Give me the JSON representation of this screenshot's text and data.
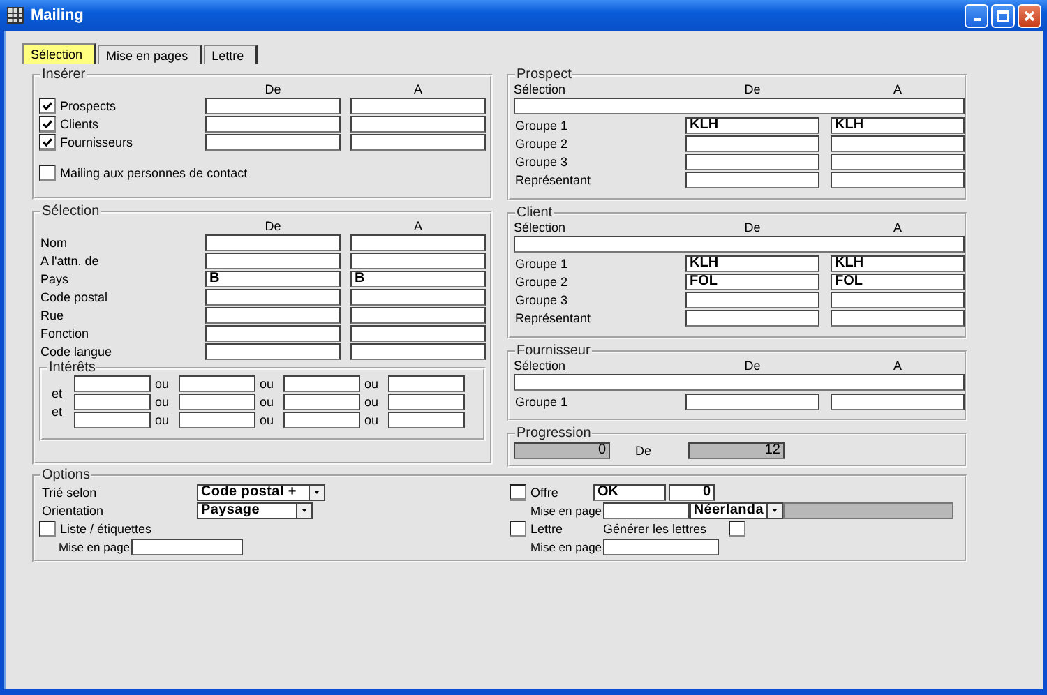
{
  "window": {
    "title": "Mailing"
  },
  "tabs": [
    {
      "label": "Sélection",
      "selected": true
    },
    {
      "label": "Mise en pages",
      "selected": false
    },
    {
      "label": "Lettre",
      "selected": false
    }
  ],
  "insert": {
    "title": "Insérer",
    "col_from": "De",
    "col_to": "A",
    "rows": [
      {
        "label": "Prospects",
        "checked": true
      },
      {
        "label": "Clients",
        "checked": true
      },
      {
        "label": "Fournisseurs",
        "checked": true
      }
    ]
  },
  "contact_mailing": {
    "label": "Mailing aux personnes de contact",
    "checked": false
  },
  "selection": {
    "title": "Sélection",
    "col_from": "De",
    "col_to": "A",
    "rows": [
      {
        "label": "Nom"
      },
      {
        "label": "A l'attn. de"
      },
      {
        "label": "Pays",
        "from": "B",
        "to": "B"
      },
      {
        "label": "Code postal"
      },
      {
        "label": "Rue"
      },
      {
        "label": "Fonction"
      },
      {
        "label": "Code langue"
      }
    ]
  },
  "interests": {
    "title": "Intérêts",
    "row_labels": [
      "et",
      "et"
    ],
    "rows": [
      {
        "separators": [
          "ou",
          "ou",
          "ou"
        ]
      },
      {
        "separators": [
          "ou",
          "ou",
          "ou"
        ]
      },
      {
        "separators": [
          "ou",
          "ou",
          "ou"
        ]
      }
    ]
  },
  "prospect": {
    "title": "Prospect",
    "selection_label": "Sélection",
    "col_from": "De",
    "col_to": "A",
    "rows": [
      {
        "label": "Groupe 1",
        "from": "KLH",
        "to": "KLH"
      },
      {
        "label": "Groupe 2"
      },
      {
        "label": "Groupe 3"
      },
      {
        "label": "Représentant"
      }
    ]
  },
  "client": {
    "title": "Client",
    "selection_label": "Sélection",
    "col_from": "De",
    "col_to": "A",
    "rows": [
      {
        "label": "Groupe 1",
        "from": "KLH",
        "to": "KLH"
      },
      {
        "label": "Groupe 2",
        "from": "FOL",
        "to": "FOL"
      },
      {
        "label": "Groupe 3"
      },
      {
        "label": "Représentant"
      }
    ]
  },
  "supplier": {
    "title": "Fournisseur",
    "selection_label": "Sélection",
    "col_from": "De",
    "col_to": "A",
    "rows": [
      {
        "label": "Groupe 1"
      }
    ]
  },
  "progress": {
    "title": "Progression",
    "current": "0",
    "of_label": "De",
    "total": "12"
  },
  "options": {
    "title": "Options",
    "sort_label": "Trié selon",
    "sort_value": "Code postal +",
    "orientation_label": "Orientation",
    "orientation_value": "Paysage",
    "list": {
      "label": "Liste / étiquettes",
      "checked": false
    },
    "list_layout_label": "Mise en page",
    "offer": {
      "label": "Offre",
      "checked": false,
      "code": "OK",
      "count": "0"
    },
    "offer_layout_label": "Mise en page",
    "language": "Néerlanda",
    "letter": {
      "label": "Lettre",
      "checked": false
    },
    "generate": {
      "label": "Générer les lettres",
      "checked": false
    },
    "letter_layout_label": "Mise en page"
  }
}
